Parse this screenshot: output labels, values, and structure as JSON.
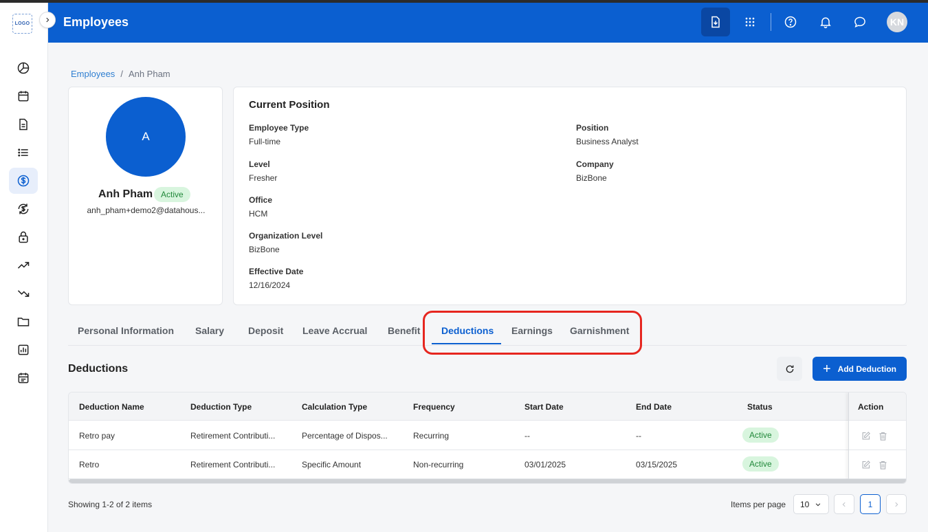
{
  "app": {
    "logo_text": "LOGO",
    "page_title": "Employees",
    "user_initials": "KN"
  },
  "sidebar": {
    "items": [
      {
        "icon": "pie-chart-icon",
        "active": false
      },
      {
        "icon": "calendar-icon",
        "active": false
      },
      {
        "icon": "document-icon",
        "active": false
      },
      {
        "icon": "list-icon",
        "active": false
      },
      {
        "icon": "dollar-icon",
        "active": true
      },
      {
        "icon": "dollar-cycle-icon",
        "active": false
      },
      {
        "icon": "lock-icon",
        "active": false
      },
      {
        "icon": "trending-up-icon",
        "active": false
      },
      {
        "icon": "trending-down-icon",
        "active": false
      },
      {
        "icon": "folder-icon",
        "active": false
      },
      {
        "icon": "bar-report-icon",
        "active": false
      },
      {
        "icon": "schedule-icon",
        "active": false
      }
    ]
  },
  "breadcrumb": {
    "root": "Employees",
    "separator": "/",
    "current": "Anh Pham"
  },
  "profile": {
    "avatar_letter": "A",
    "name": "Anh Pham",
    "status": "Active",
    "email": "anh_pham+demo2@datahous..."
  },
  "position": {
    "title": "Current Position",
    "fields": {
      "employee_type": {
        "label": "Employee Type",
        "value": "Full-time"
      },
      "position": {
        "label": "Position",
        "value": "Business Analyst"
      },
      "level": {
        "label": "Level",
        "value": "Fresher"
      },
      "company": {
        "label": "Company",
        "value": "BizBone"
      },
      "office": {
        "label": "Office",
        "value": "HCM"
      },
      "org_level": {
        "label": "Organization Level",
        "value": "BizBone"
      },
      "effective_date": {
        "label": "Effective Date",
        "value": "12/16/2024"
      }
    }
  },
  "tabs": [
    {
      "label": "Personal Information"
    },
    {
      "label": "Salary"
    },
    {
      "label": "Deposit"
    },
    {
      "label": "Leave Accrual"
    },
    {
      "label": "Benefit"
    },
    {
      "label": "Deductions",
      "active": true
    },
    {
      "label": "Earnings"
    },
    {
      "label": "Garnishment"
    }
  ],
  "deductions": {
    "title": "Deductions",
    "add_label": "Add Deduction",
    "columns": [
      "Deduction Name",
      "Deduction Type",
      "Calculation Type",
      "Frequency",
      "Start Date",
      "End Date",
      "Status",
      "Action"
    ],
    "rows": [
      {
        "name": "Retro pay",
        "type": "Retirement Contributi...",
        "calc": "Percentage of Dispos...",
        "frequency": "Recurring",
        "start": "--",
        "end": "--",
        "status": "Active"
      },
      {
        "name": "Retro",
        "type": "Retirement Contributi...",
        "calc": "Specific Amount",
        "frequency": "Non-recurring",
        "start": "03/01/2025",
        "end": "03/15/2025",
        "status": "Active"
      }
    ]
  },
  "pagination": {
    "showing": "Showing 1-2 of 2 items",
    "items_per_page_label": "Items per page",
    "items_per_page": "10",
    "current_page": "1"
  },
  "colors": {
    "primary": "#0b5fd0",
    "active_badge_bg": "#d8f5de",
    "active_badge_text": "#21883a",
    "highlight": "#e6261f"
  }
}
